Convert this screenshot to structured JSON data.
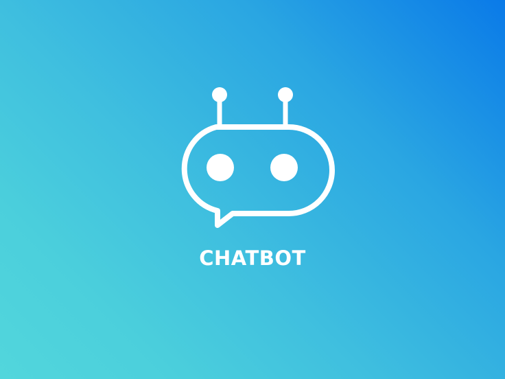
{
  "brand": {
    "name": "CHATBOT",
    "logo_icon": "chatbot-robot-speech-bubble-icon",
    "foreground_color": "#ffffff"
  },
  "background": {
    "gradient_start": "#0a7ae8",
    "gradient_end": "#52d6dc"
  }
}
